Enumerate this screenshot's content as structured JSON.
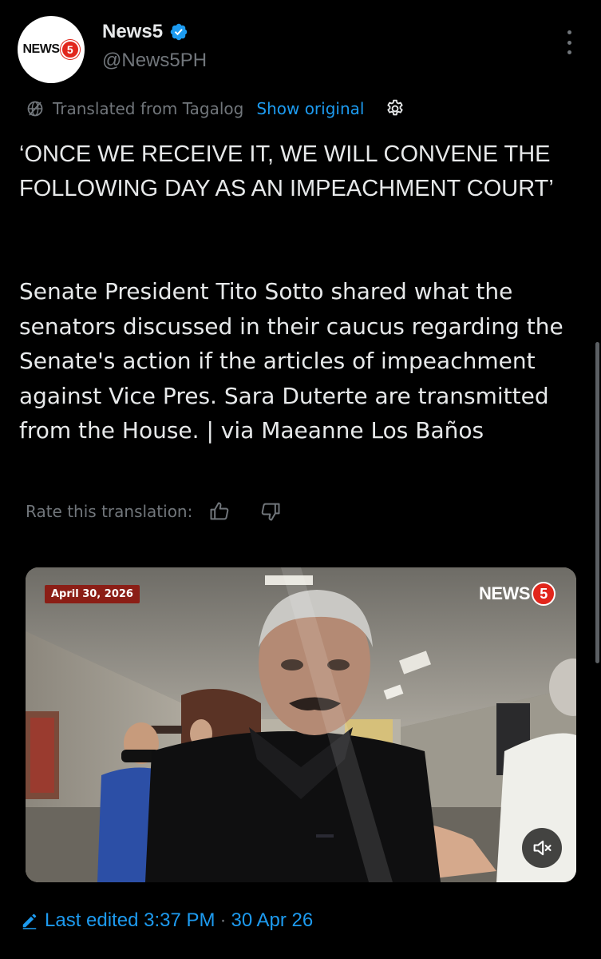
{
  "tweet": {
    "author": {
      "display_name": "News5",
      "handle": "@News5PH",
      "verified": true,
      "avatar_logo_text": "NEWS",
      "avatar_logo_number": "5"
    },
    "translation": {
      "label": "Translated from Tagalog",
      "show_original": "Show original"
    },
    "headline": "‘ONCE WE RECEIVE IT, WE WILL CONVENE THE FOLLOWING DAY AS AN IMPEACHMENT COURT’",
    "body": "Senate President Tito Sotto shared what the senators discussed in their caucus regarding the Senate's action if the articles of impeachment against Vice Pres. Sara Duterte are transmitted from the House. | via Maeanne Los Baños",
    "rate_translation": "Rate this translation:",
    "media": {
      "date_badge": "April 30, 2026",
      "logo_text": "NEWS",
      "logo_number": "5",
      "muted": true
    },
    "edited": {
      "label": "Last edited 3:37 PM",
      "separator": "·",
      "date": "30 Apr 26"
    }
  },
  "colors": {
    "background": "#000000",
    "text": "#e7e9ea",
    "secondary": "#71767b",
    "accent": "#1d9bf0",
    "brand_red": "#e1261c"
  },
  "icons": {
    "verified": "verified-badge-icon",
    "more": "more-options-icon",
    "translate": "translate-globe-icon",
    "settings": "settings-gear-icon",
    "thumbs_up": "thumbs-up-icon",
    "thumbs_down": "thumbs-down-icon",
    "mute": "speaker-muted-icon",
    "edit": "pencil-icon"
  }
}
